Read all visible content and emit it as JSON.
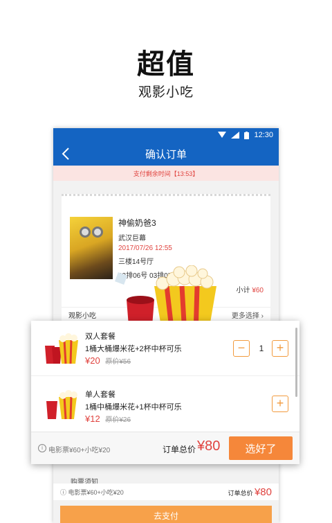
{
  "promo": {
    "title": "超值",
    "subtitle": "观影小吃"
  },
  "status_bar": {
    "time": "12:30"
  },
  "nav": {
    "title": "确认订单"
  },
  "timer": {
    "text": "支付剩余时间【13:53】"
  },
  "movie": {
    "title": "神偷奶爸3",
    "cinema": "武汉巨幕",
    "showtime": "2017/07/26 12:55",
    "hall": "三楼14号厅",
    "seats": "03排06号   03排07号",
    "subtotal_label": "小计",
    "subtotal_value": "¥60"
  },
  "snack_row": {
    "label": "观影小吃",
    "more": "更多选择 ›"
  },
  "peek_text": "购票须知",
  "combos": [
    {
      "name": "双人套餐",
      "desc": "1桶大桶爆米花+2杯中杯可乐",
      "price": "¥20",
      "orig_label": "原价",
      "orig_price": "¥56",
      "qty": "1"
    },
    {
      "name": "单人套餐",
      "desc": "1桶中桶爆米花+1杯中杯可乐",
      "price": "¥12",
      "orig_label": "原价",
      "orig_price": "¥26",
      "qty": ""
    }
  ],
  "popup_footer": {
    "breakdown": "电影票¥60+小吃¥20",
    "total_label": "订单总价",
    "total_value": "¥80",
    "done_button": "选好了"
  },
  "bottom": {
    "breakdown": "电影票¥60+小吃¥20",
    "total_label": "订单总价",
    "total_value": "¥80",
    "pay_button": "去支付"
  },
  "colors": {
    "primary_blue": "#1464c2",
    "accent_orange": "#f5873a",
    "price_red": "#e0433f"
  }
}
